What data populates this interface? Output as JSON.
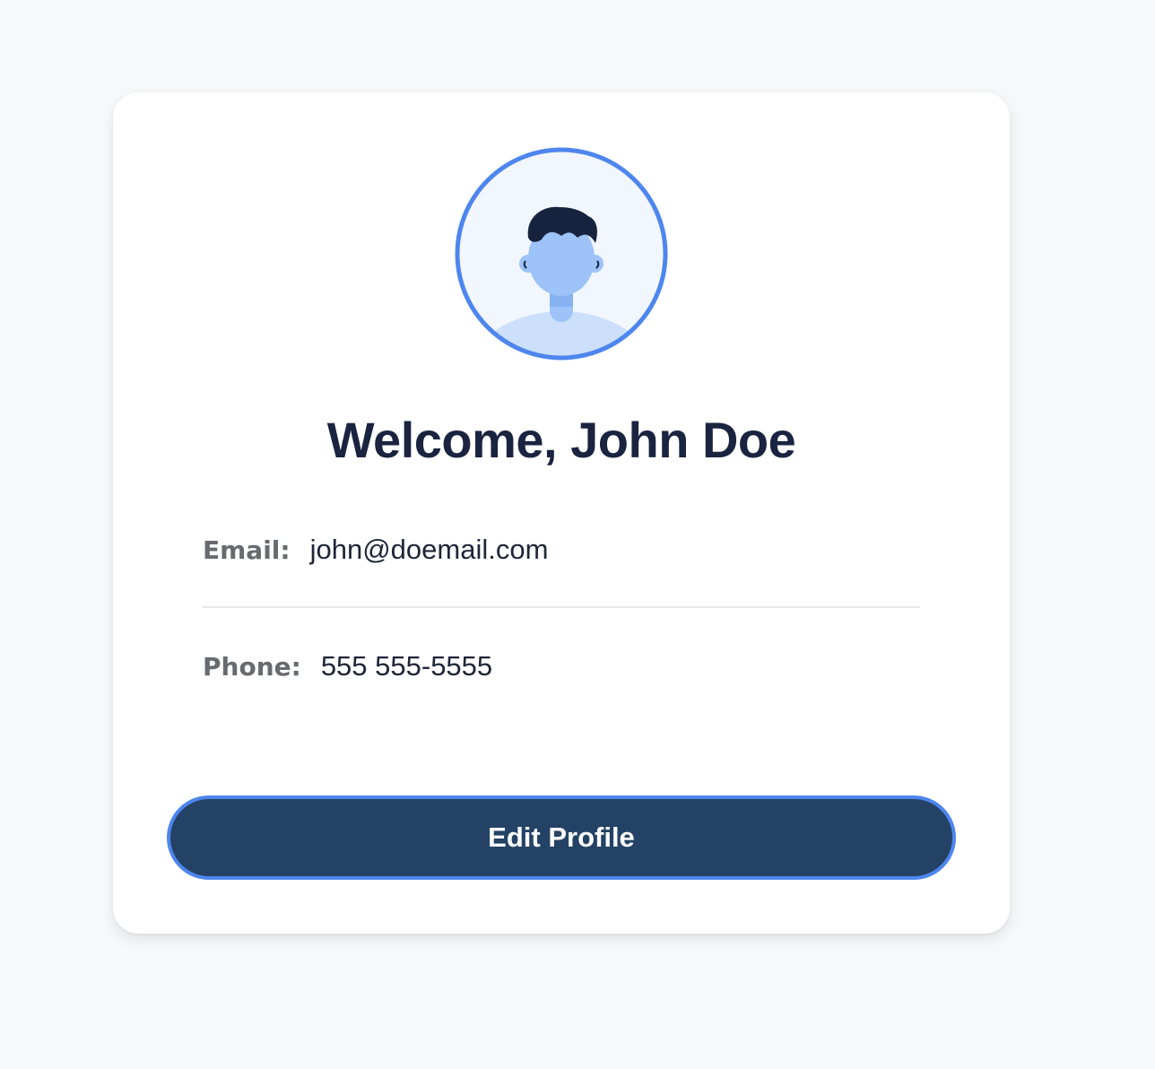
{
  "profile": {
    "welcome_text": "Welcome, John Doe",
    "avatar_icon": "user-avatar-icon"
  },
  "info": {
    "email_label": "Email:",
    "email_value": "john@doemail.com",
    "phone_label": "Phone:",
    "phone_value": "555 555-5555"
  },
  "actions": {
    "edit_label": "Edit Profile"
  },
  "colors": {
    "background": "#f7f8fa",
    "card": "#ffffff",
    "accent": "#4e86ee",
    "button": "#244266",
    "heading": "#1a2440",
    "label": "#676a6f",
    "avatar_skin": "#9dc3f8",
    "avatar_hair": "#16233f"
  }
}
